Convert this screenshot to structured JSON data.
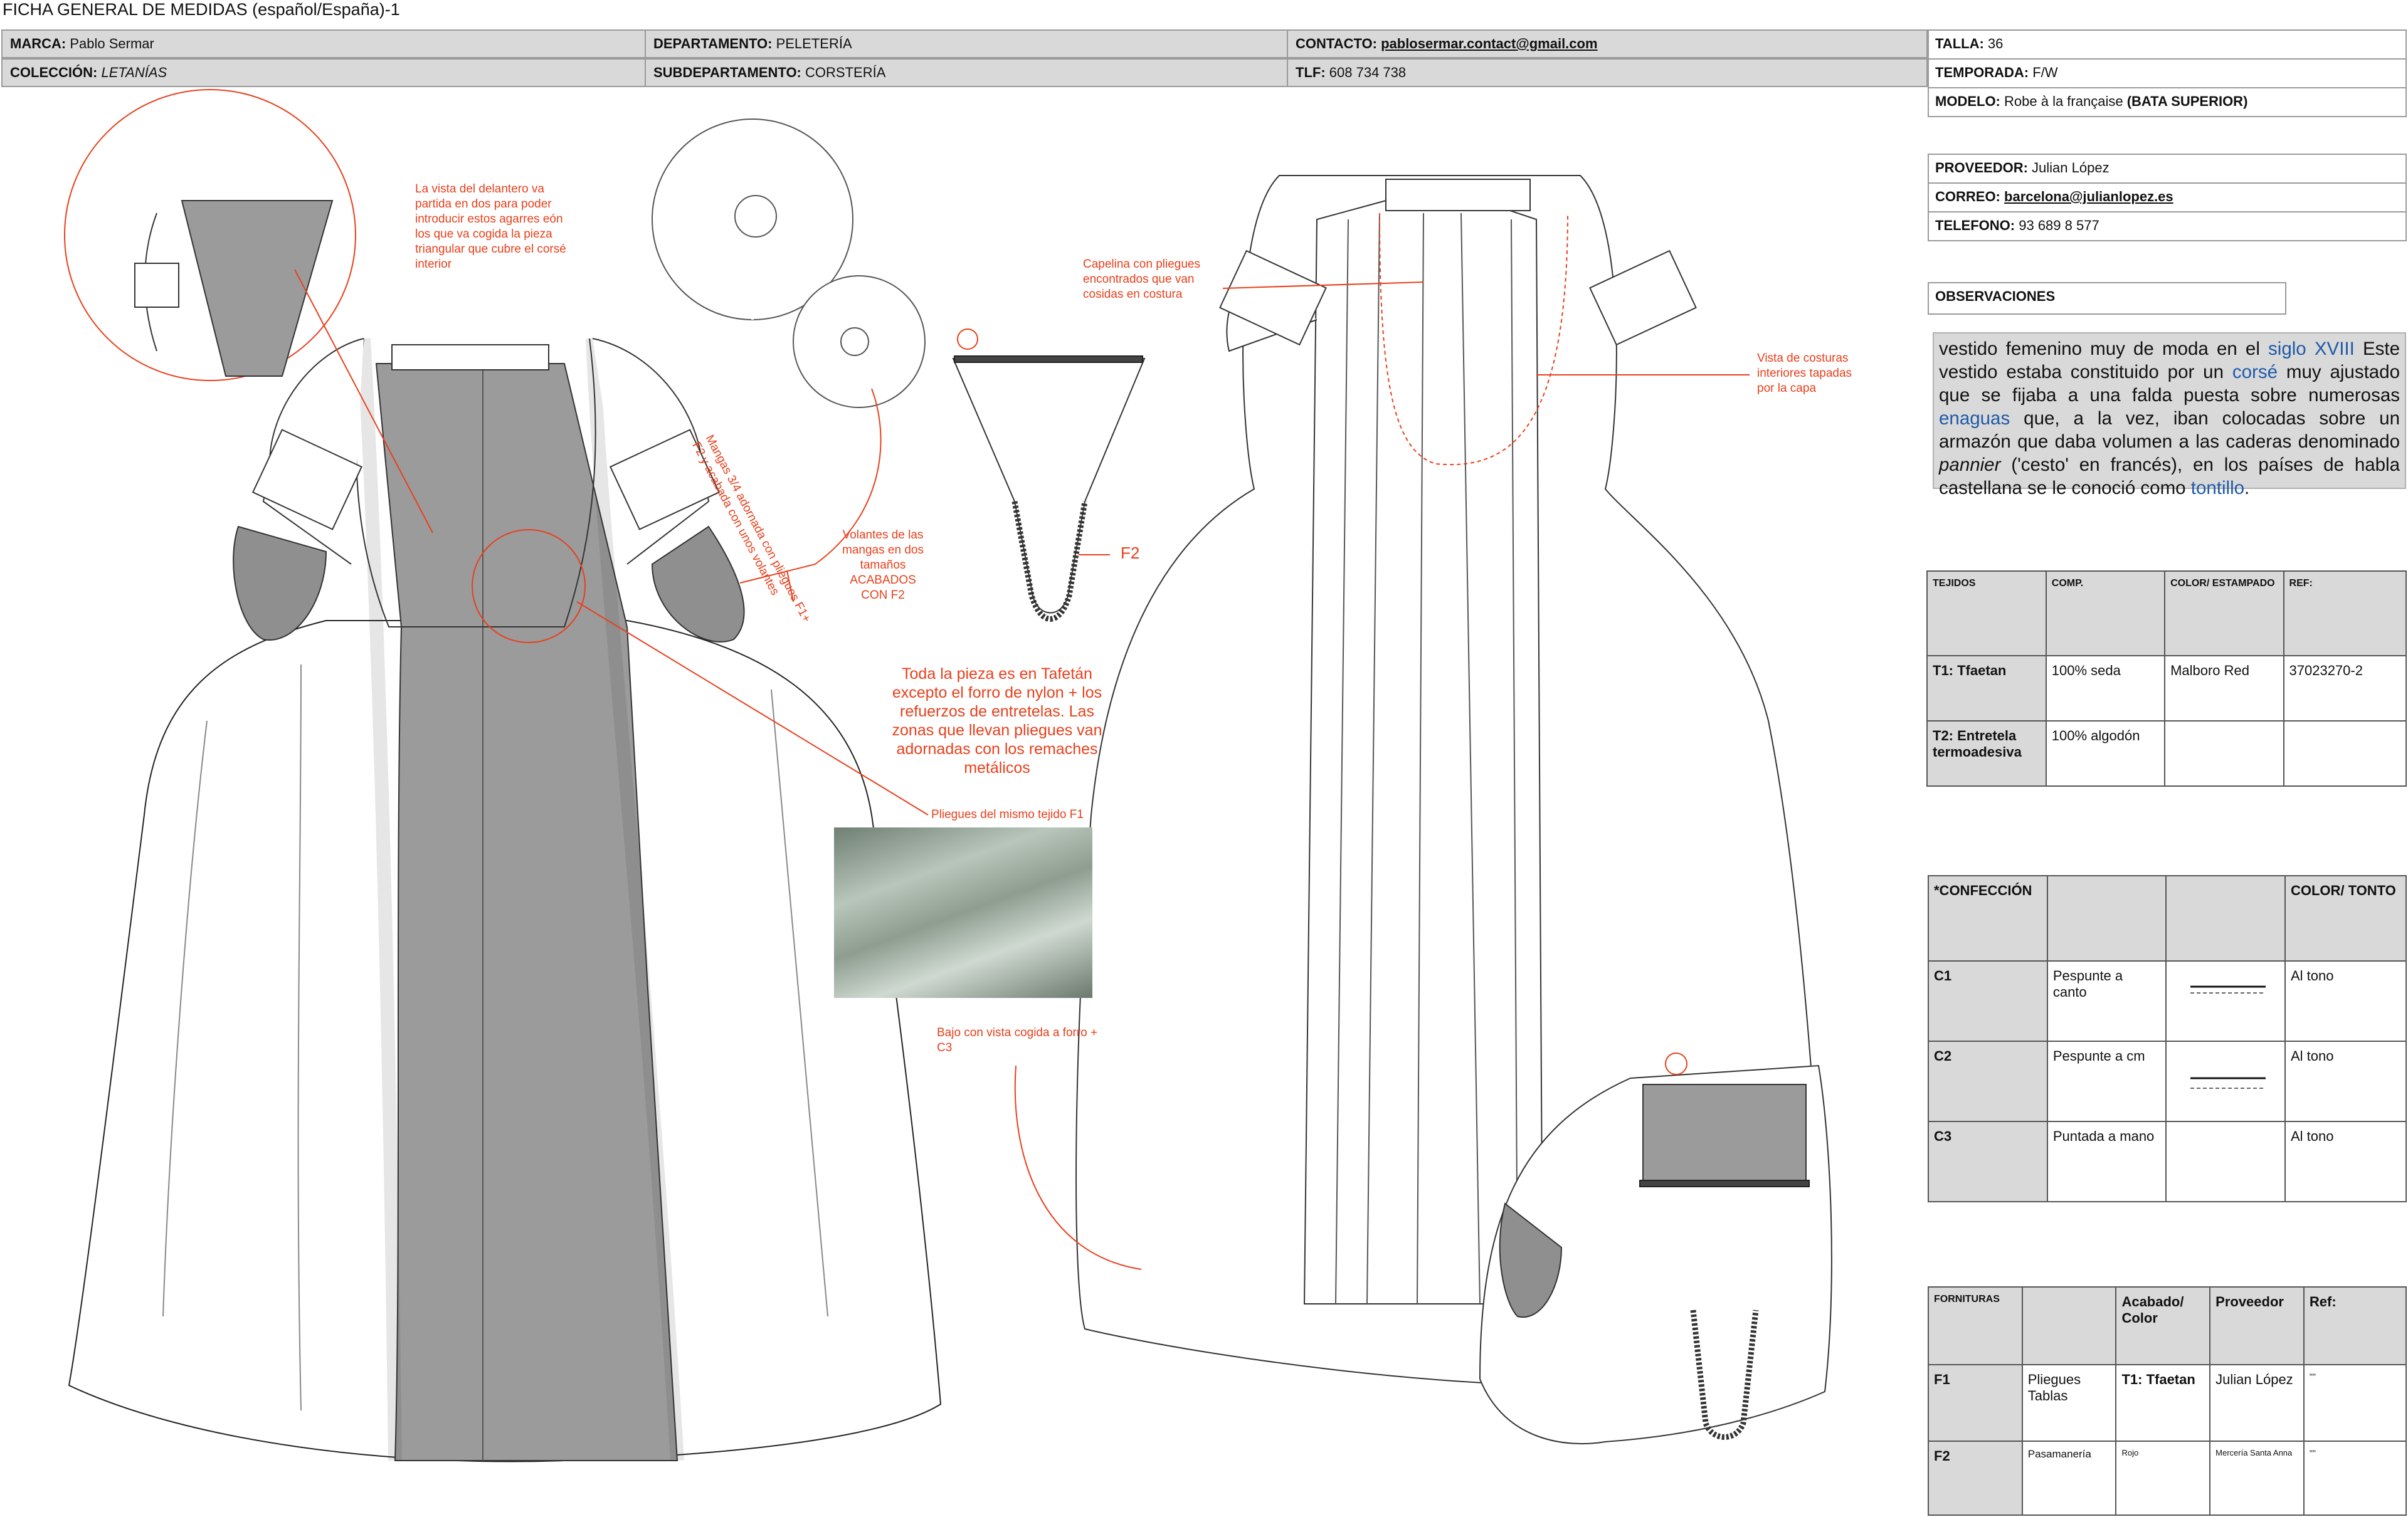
{
  "doc_title": "FICHA GENERAL DE MEDIDAS (español/España)-1",
  "header": {
    "marca_label": "MARCA:",
    "marca": "Pablo Sermar",
    "coleccion_label": "COLECCIÓN:",
    "coleccion": "LETANÍAS",
    "departamento_label": "DEPARTAMENTO:",
    "departamento": "PELETERÍA",
    "subdepartamento_label": "SUBDEPARTAMENTO:",
    "subdepartamento": "CORSTERÍA",
    "contacto_label": "CONTACTO:",
    "contacto": "pablosermar.contact@gmail.com",
    "tlf_label": "TLF:",
    "tlf": "608 734 738"
  },
  "right_info": {
    "talla_label": "TALLA:",
    "talla": "36",
    "temporada_label": "TEMPORADA:",
    "temporada": "F/W",
    "modelo_label": "MODELO:",
    "modelo": "Robe à la française",
    "modelo_bold": "(BATA SUPERIOR)",
    "proveedor_label": "PROVEEDOR:",
    "proveedor": "Julian López",
    "correo_label": "CORREO:",
    "correo": "barcelona@julianlopez.es",
    "telefono_label": "TELEFONO:",
    "telefono": "93 689 8 577"
  },
  "observaciones": {
    "label": "OBSERVACIONES",
    "t1": "vestido femenino muy de moda en el ",
    "l1": "siglo XVIII",
    "t2": " Este vestido estaba constituido por un ",
    "l2": "corsé",
    "t3": " muy ajustado que se fijaba a una falda puesta sobre numerosas ",
    "l3": "enaguas",
    "t4": " que, a la vez, iban colocadas sobre un armazón que daba volumen a las caderas denominado ",
    "i1": "pannier",
    "t5": " ('cesto' en francés), en los países de habla castellana se le conoció como ",
    "l4": "tontillo",
    "t6": "."
  },
  "tejidos": {
    "headers": [
      "TEJIDOS",
      "COMP.",
      "COLOR/ ESTAMPADO",
      "REF:"
    ],
    "rows": [
      [
        "T1:  Tfaetan",
        "100% seda",
        "Malboro Red",
        "37023270-2"
      ],
      [
        "T2: Entretela termoadesiva",
        "100% algodón",
        "",
        ""
      ]
    ]
  },
  "confeccion": {
    "headers": [
      "*CONFECCIÓN",
      "",
      "",
      "COLOR/ TONTO"
    ],
    "rows": [
      [
        "C1",
        "Pespunte a canto",
        "",
        "Al tono"
      ],
      [
        "C2",
        "Pespunte a cm",
        "",
        "Al tono"
      ],
      [
        "C3",
        "Puntada a mano",
        "",
        "Al tono"
      ]
    ]
  },
  "fornituras": {
    "headers": [
      "FORNITURAS",
      "",
      "Acabado/ Color",
      "Proveedor",
      "Ref:"
    ],
    "rows": [
      [
        "F1",
        "Pliegues Tablas",
        "T1:  Tfaetan",
        "Julian López",
        "\"\""
      ],
      [
        "F2",
        "Pasamanería",
        "Rojo",
        "Mercería Santa Anna",
        "\"\""
      ]
    ]
  },
  "notes": {
    "n1": "La vista del delantero va partida en dos para poder introducir estos agarres eón los que va cogida la pieza triangular que cubre el corsé interior",
    "n2": "Mangas 3/4 adornada con pliegues F1+ F2 y acabada con unos volantes",
    "n3": "Volantes de las mangas en dos tamaños ACABADOS CON F2",
    "n4": "Toda la pieza es en Tafetán excepto el forro de nylon + los refuerzos de entretelas. Las zonas que llevan pliegues van adornadas con los remaches metálicos",
    "n5": "Pliegues del mismo tejido F1",
    "n6": "Bajo con vista cogida a forro + C3",
    "n7": "Capelina con pliegues encontrados que van cosidas en costura",
    "n8": "Vista de costuras interiores tapadas por la capa",
    "f2": "F2"
  },
  "colors": {
    "accent": "#e8401c",
    "grey_fill": "#9b9b9b",
    "header_bg": "#d9d9d9",
    "link": "#1f5aa8"
  }
}
